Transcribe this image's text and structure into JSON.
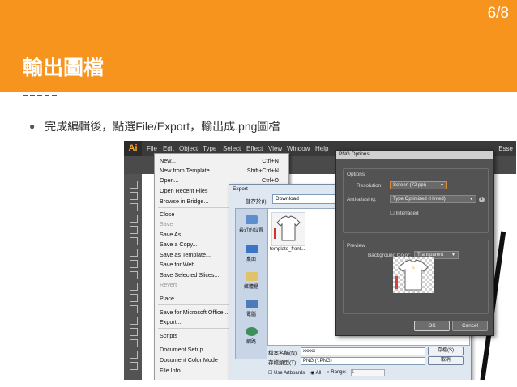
{
  "slide": {
    "page_number": "6/8",
    "title": "輸出圖檔",
    "bullet": "完成編輯後，點選File/Export，輸出成.png圖檔",
    "colors": {
      "header": "#f7941d",
      "title_text": "#ffffff"
    }
  },
  "app": {
    "logo": "Ai",
    "menu": [
      "File",
      "Edit",
      "Object",
      "Type",
      "Select",
      "Effect",
      "View",
      "Window",
      "Help"
    ],
    "workspace": "Esse"
  },
  "file_menu": {
    "items": [
      {
        "label": "New...",
        "shortcut": "Ctrl+N"
      },
      {
        "label": "New from Template...",
        "shortcut": "Shift+Ctrl+N"
      },
      {
        "label": "Open...",
        "shortcut": "Ctrl+O"
      },
      {
        "label": "Open Recent Files",
        "shortcut": ""
      },
      {
        "label": "Browse in Bridge...",
        "shortcut": ""
      },
      {
        "label": "Close",
        "shortcut": ""
      },
      {
        "label": "Save",
        "shortcut": ""
      },
      {
        "label": "Save As...",
        "shortcut": ""
      },
      {
        "label": "Save a Copy...",
        "shortcut": ""
      },
      {
        "label": "Save as Template...",
        "shortcut": ""
      },
      {
        "label": "Save for Web...",
        "shortcut": ""
      },
      {
        "label": "Save Selected Slices...",
        "shortcut": ""
      },
      {
        "label": "Revert",
        "shortcut": ""
      },
      {
        "label": "Place...",
        "shortcut": ""
      },
      {
        "label": "Save for Microsoft Office...",
        "shortcut": ""
      },
      {
        "label": "Export...",
        "shortcut": ""
      },
      {
        "label": "Scripts",
        "shortcut": ""
      },
      {
        "label": "Document Setup...",
        "shortcut": ""
      },
      {
        "label": "Document Color Mode",
        "shortcut": ""
      },
      {
        "label": "File Info...",
        "shortcut": ""
      }
    ]
  },
  "export_dialog": {
    "title": "Export",
    "look_in_label": "儲存於(I):",
    "look_in_value": "Download",
    "places": [
      "最近的位置",
      "桌面",
      "媒體櫃",
      "電腦",
      "網路"
    ],
    "file": {
      "name": "template_front..."
    },
    "filename_label": "檔案名稱(N):",
    "filename_value": "xxxxx",
    "filetype_label": "存檔類型(T):",
    "filetype_value": "PNG (*.PNG)",
    "save_button": "存檔(S)",
    "cancel_button": "取消",
    "use_artboards": "Use Artboards",
    "all_label": "All",
    "range_label": "Range:",
    "range_value": "1"
  },
  "png_options": {
    "title": "PNG Options",
    "options_group": "Options",
    "resolution_label": "Resolution:",
    "resolution_value": "Screen (72 ppi)",
    "antialias_label": "Anti-aliasing:",
    "antialias_value": "Type Optimized (Hinted)",
    "interlaced_label": "Interlaced",
    "preview_group": "Preview",
    "bg_label": "Background Color:",
    "bg_value": "Transparent",
    "ok_button": "OK",
    "cancel_button": "Cancel"
  }
}
